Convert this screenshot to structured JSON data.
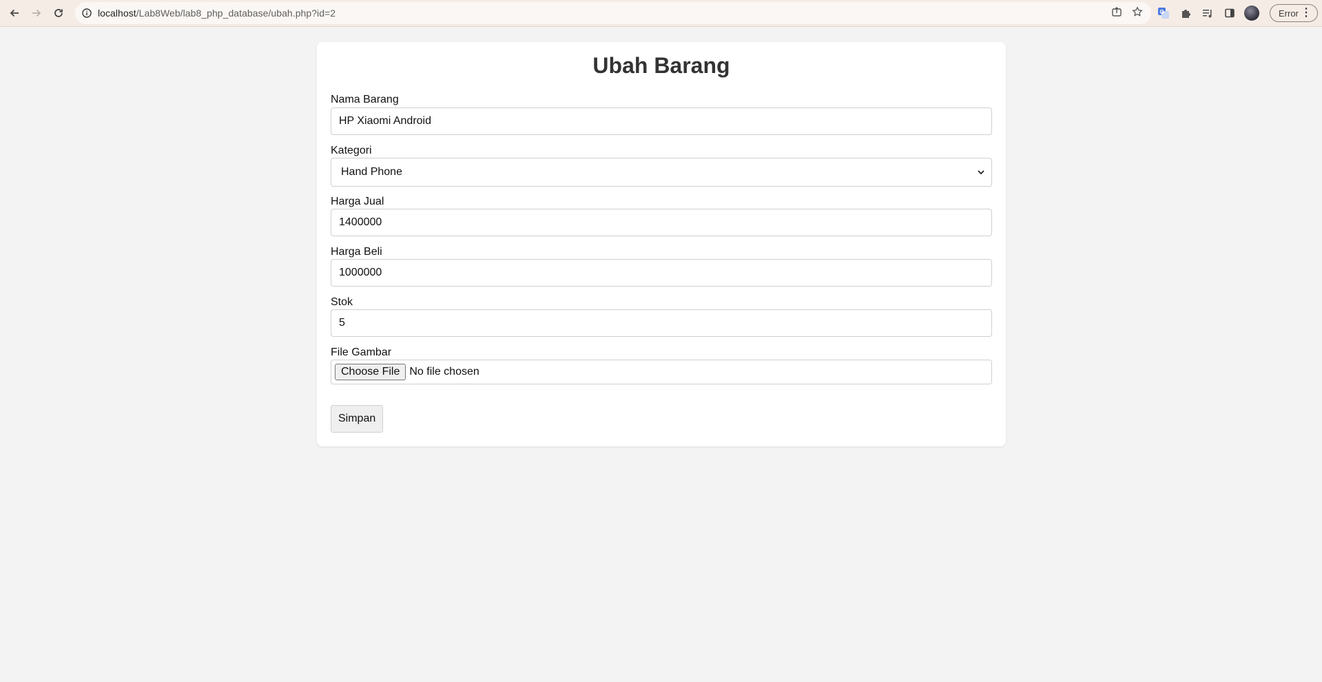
{
  "browser": {
    "url_host": "localhost",
    "url_path": "/Lab8Web/lab8_php_database/ubah.php?id=2",
    "profile_status": "Error"
  },
  "icons": {
    "back": "back-arrow-icon",
    "forward": "forward-arrow-icon",
    "reload": "reload-icon",
    "site_info": "info-icon",
    "share": "share-icon",
    "bookmark": "star-icon",
    "translate": "translate-icon",
    "extensions": "puzzle-icon",
    "media": "playlist-icon",
    "side_panel": "side-panel-icon",
    "menu": "kebab-menu-icon"
  },
  "form": {
    "title": "Ubah Barang",
    "nama_barang": {
      "label": "Nama Barang",
      "value": "HP Xiaomi Android"
    },
    "kategori": {
      "label": "Kategori",
      "value": "Hand Phone"
    },
    "harga_jual": {
      "label": "Harga Jual",
      "value": "1400000"
    },
    "harga_beli": {
      "label": "Harga Beli",
      "value": "1000000"
    },
    "stok": {
      "label": "Stok",
      "value": "5"
    },
    "file_gambar": {
      "label": "File Gambar",
      "button": "Choose File",
      "status": "No file chosen"
    },
    "submit": "Simpan"
  }
}
